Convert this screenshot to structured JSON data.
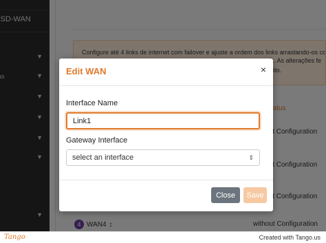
{
  "sidebar": {
    "brand": "k SD-WAN",
    "items": [
      {
        "label": ""
      },
      {
        "label": "as"
      },
      {
        "label": ""
      },
      {
        "label": ""
      },
      {
        "label": ""
      },
      {
        "label": ""
      },
      {
        "label": ""
      }
    ]
  },
  "main": {
    "info_line1": "Configure até 4 links de internet com failover e ajuste a ordem dos links arrastando-os com",
    "info_line2": "ik. As alterações fe",
    "info_line3": "ito.",
    "status_header": "tatus",
    "config_rows": [
      "it Configuration",
      "it Configuration",
      "it Configuration",
      "it Configuration"
    ],
    "wan4": {
      "number": "4",
      "label": "WAN4",
      "status": "without Configuration"
    }
  },
  "modal": {
    "title": "Edit WAN",
    "close_icon": "×",
    "interface_name_label": "Interface Name",
    "interface_name_value": "Link1",
    "gateway_label": "Gateway Interface",
    "gateway_selected": "select an interface",
    "close_button": "Close",
    "save_button": "Save"
  },
  "footer": {
    "logo": "Tango",
    "credit": "Created with Tango.us"
  },
  "colors": {
    "accent": "#e07a2c",
    "sidebar_bg": "#2b2b2b",
    "close_button_bg": "#6c757d",
    "save_button_bg": "#f6c9a3",
    "wan_badge": "#6b3fa0"
  }
}
